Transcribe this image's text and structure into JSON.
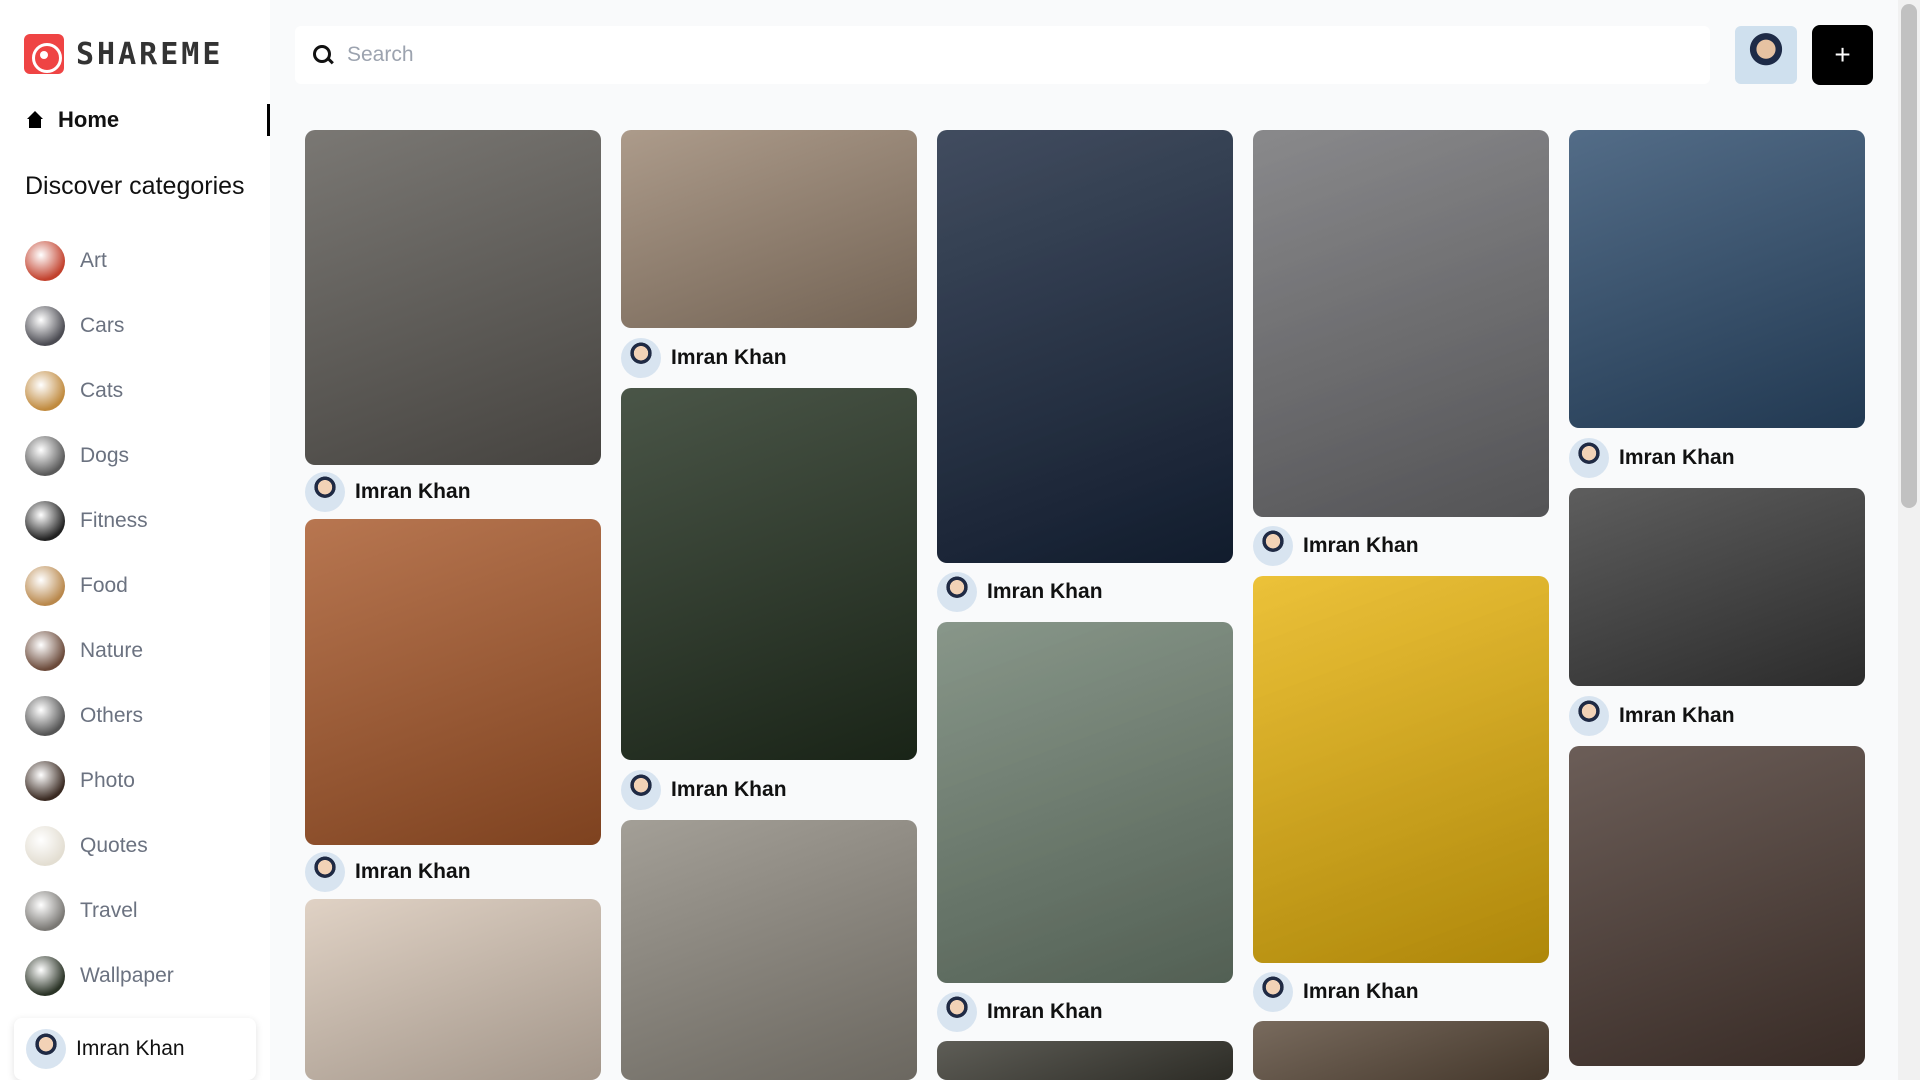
{
  "app": {
    "brand": "SHAREME"
  },
  "nav": {
    "home_label": "Home",
    "discover_title": "Discover categories"
  },
  "categories": [
    {
      "label": "Art",
      "color": "#c2412d"
    },
    {
      "label": "Cars",
      "color": "#4b4b52"
    },
    {
      "label": "Cats",
      "color": "#c08a3e"
    },
    {
      "label": "Dogs",
      "color": "#5a5a5a"
    },
    {
      "label": "Fitness",
      "color": "#222222"
    },
    {
      "label": "Food",
      "color": "#b9884c"
    },
    {
      "label": "Nature",
      "color": "#6b4a3a"
    },
    {
      "label": "Others",
      "color": "#555555"
    },
    {
      "label": "Photo",
      "color": "#3a2a22"
    },
    {
      "label": "Quotes",
      "color": "#e3ded2"
    },
    {
      "label": "Travel",
      "color": "#7a7874"
    },
    {
      "label": "Wallpaper",
      "color": "#2a3326"
    }
  ],
  "current_user": {
    "name": "Imran Khan"
  },
  "search": {
    "placeholder": "Search"
  },
  "add_button": {
    "label": "+"
  },
  "pins": [
    {
      "author": "Imran Khan",
      "h": 370,
      "color": "#5d5a55",
      "col": 0
    },
    {
      "author": "Imran Khan",
      "h": 360,
      "color": "#a8582a",
      "col": 0
    },
    {
      "author": "",
      "h": 200,
      "color": "#d9c8b8",
      "col": 0
    },
    {
      "author": "Imran Khan",
      "h": 198,
      "color": "#9a8571",
      "col": 1
    },
    {
      "author": "Imran Khan",
      "h": 372,
      "color": "#22301f",
      "col": 1
    },
    {
      "author": "",
      "h": 260,
      "color": "#8f8a80",
      "col": 1
    },
    {
      "author": "Imran Khan",
      "h": 446,
      "color": "#17253c",
      "col": 2
    },
    {
      "author": "Imran Khan",
      "h": 372,
      "color": "#6e8070",
      "col": 2
    },
    {
      "author": "",
      "h": 40,
      "color": "#3b3a32",
      "col": 2
    },
    {
      "author": "Imran Khan",
      "h": 396,
      "color": "#6f6f72",
      "col": 3
    },
    {
      "author": "Imran Khan",
      "h": 396,
      "color": "#e8b40d",
      "col": 3
    },
    {
      "author": "",
      "h": 60,
      "color": "#5b4a3a",
      "col": 3
    },
    {
      "author": "Imran Khan",
      "h": 298,
      "color": "#2d4c6d",
      "col": 4
    },
    {
      "author": "Imran Khan",
      "h": 198,
      "color": "#3a3a3a",
      "col": 4
    },
    {
      "author": "",
      "h": 320,
      "color": "#4b3a33",
      "col": 4
    }
  ]
}
